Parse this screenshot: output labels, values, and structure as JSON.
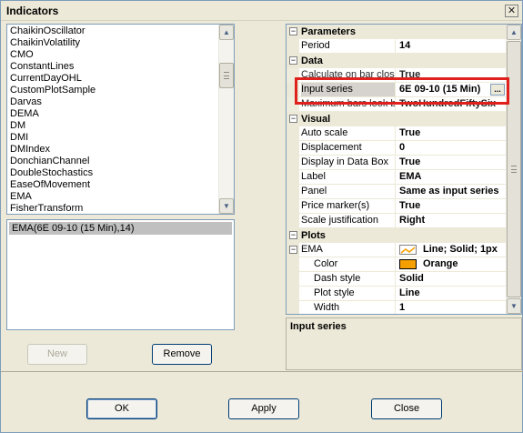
{
  "window": {
    "title": "Indicators",
    "close_glyph": "✕"
  },
  "indicator_list": {
    "items": [
      "ChaikinOscillator",
      "ChaikinVolatility",
      "CMO",
      "ConstantLines",
      "CurrentDayOHL",
      "CustomPlotSample",
      "Darvas",
      "DEMA",
      "DM",
      "DMI",
      "DMIndex",
      "DonchianChannel",
      "DoubleStochastics",
      "EaseOfMovement",
      "EMA",
      "FisherTransform"
    ]
  },
  "instances": {
    "items": [
      "EMA(6E 09-10 (15 Min),14)"
    ]
  },
  "buttons": {
    "new": "New",
    "remove": "Remove",
    "ok": "OK",
    "apply": "Apply",
    "close": "Close"
  },
  "properties": {
    "parameters": {
      "header": "Parameters",
      "rows": [
        {
          "name": "Period",
          "value": "14"
        }
      ]
    },
    "data": {
      "header": "Data",
      "rows": [
        {
          "name": "Calculate on bar close",
          "value": "True"
        },
        {
          "name": "Input series",
          "value": "6E 09-10 (15 Min)",
          "button": "..."
        },
        {
          "name": "Maximum bars look back",
          "value": "TwoHundredFiftySix"
        }
      ]
    },
    "visual": {
      "header": "Visual",
      "rows": [
        {
          "name": "Auto scale",
          "value": "True"
        },
        {
          "name": "Displacement",
          "value": "0"
        },
        {
          "name": "Display in Data Box",
          "value": "True"
        },
        {
          "name": "Label",
          "value": "EMA"
        },
        {
          "name": "Panel",
          "value": "Same as input series"
        },
        {
          "name": "Price marker(s)",
          "value": "True"
        },
        {
          "name": "Scale justification",
          "value": "Right"
        }
      ]
    },
    "plots": {
      "header": "Plots",
      "ema": {
        "name": "EMA",
        "value": "Line; Solid; 1px"
      },
      "rows": [
        {
          "name": "Color",
          "value": "Orange",
          "color": "#f5a000"
        },
        {
          "name": "Dash style",
          "value": "Solid"
        },
        {
          "name": "Plot style",
          "value": "Line"
        },
        {
          "name": "Width",
          "value": "1"
        }
      ]
    }
  },
  "description": {
    "title": "Input series"
  },
  "toggles": {
    "minus": "−"
  },
  "scroll": {
    "up": "▲",
    "down": "▼"
  },
  "colors": {
    "highlight_box": "#e0201c",
    "orange": "#f5a000"
  }
}
